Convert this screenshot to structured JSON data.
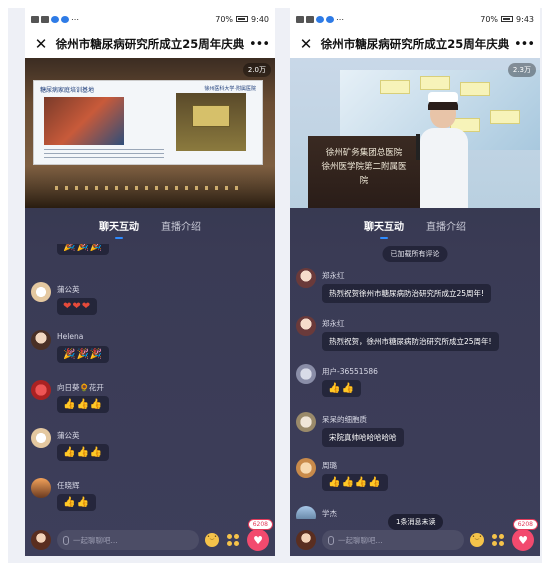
{
  "status_left": {
    "phone1": "⋯",
    "phone2": "⋯"
  },
  "status_right": {
    "phone1_battery": "70%",
    "phone1_time": "9:40",
    "phone2_battery": "70%",
    "phone2_time": "9:43"
  },
  "titlebar": {
    "title": "徐州市糖尿病研究所成立25周年庆典",
    "close": "✕",
    "more": "•••"
  },
  "video": {
    "phone1_viewers": "2.0万",
    "phone2_viewers": "2.3万",
    "phone2_sign_line1": "徐州矿务集团总医院",
    "phone2_sign_line2": "徐州医学院第二附属医院",
    "phone1_slide_title": "糖尿病家庭培训基地",
    "phone1_slide_right": "徐州医科大学·附属医院"
  },
  "tabs": {
    "chat": "聊天互动",
    "intro": "直播介绍"
  },
  "phone1_chat": [
    {
      "name": "",
      "text": "🎉🎉🎉",
      "kind": "party"
    },
    {
      "name": "蒲公英",
      "text": "❤❤❤",
      "kind": "heart"
    },
    {
      "name": "Helena",
      "text": "🎉🎉🎉",
      "kind": "party"
    },
    {
      "name": "向日葵🌻花开",
      "text": "👍👍👍",
      "kind": "thumb"
    },
    {
      "name": "蒲公英",
      "text": "👍👍👍",
      "kind": "thumb"
    },
    {
      "name": "任晓辉",
      "text": "👍👍",
      "kind": "thumb"
    }
  ],
  "phone2_chat": {
    "system_note": "已加载所有评论",
    "messages": [
      {
        "name": "郑永红",
        "text": "热烈祝贺徐州市糖尿病防治研究所成立25周年!"
      },
      {
        "name": "郑永红",
        "text": "热烈祝贺，徐州市糖尿病防治研究所成立25周年!"
      },
      {
        "name": "用户-36551586",
        "text": "👍👍"
      },
      {
        "name": "呆呆的细胞质",
        "text": "宋院真帅哈哈哈哈哈"
      },
      {
        "name": "周璐",
        "text": "👍👍👍👍"
      },
      {
        "name": "学杰",
        "text": ""
      }
    ],
    "unread": "1条消息未读"
  },
  "bottom": {
    "placeholder": "一起聊聊吧...",
    "like_count_1": "6208",
    "like_count_2": "6208"
  },
  "colors": {
    "accent": "#2f8bff",
    "like": "#f24a6e",
    "panel": "#3a3b55"
  }
}
